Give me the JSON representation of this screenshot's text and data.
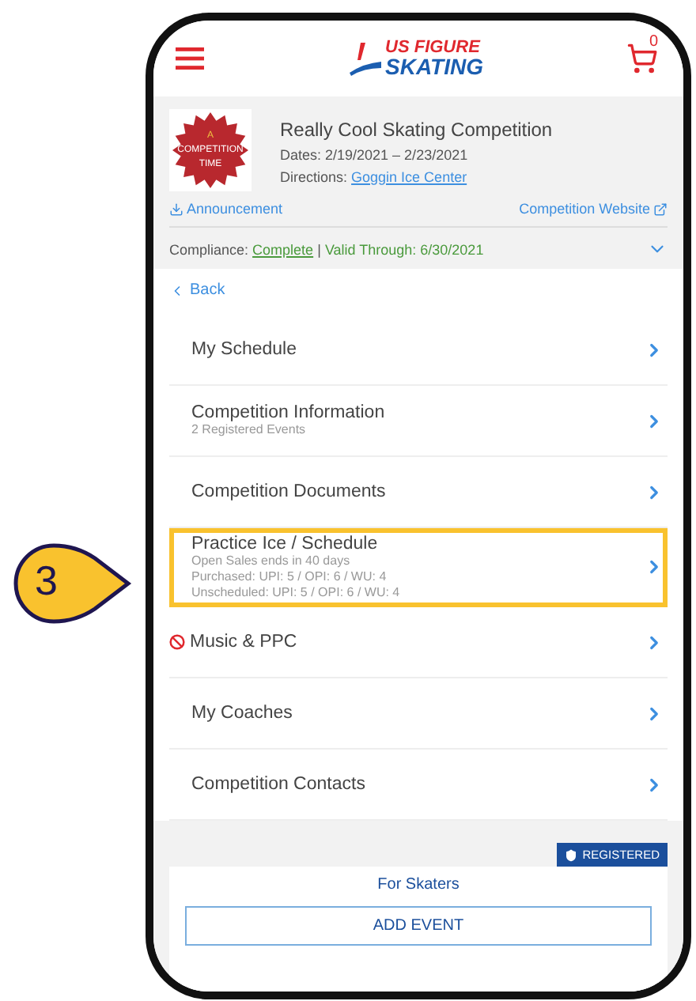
{
  "callout": {
    "number": "3"
  },
  "header": {
    "logo_top": "US FIGURE",
    "logo_bottom": "SKATING",
    "cart_count": "0"
  },
  "competition": {
    "badge_lines": [
      "A",
      "COMPETITION",
      "TIME"
    ],
    "title": "Really Cool Skating Competition",
    "dates": "Dates: 2/19/2021 – 2/23/2021",
    "directions_label": "Directions:",
    "directions_link": "Goggin Ice Center",
    "announcement": "Announcement",
    "website": "Competition Website",
    "compliance_label": "Compliance:",
    "compliance_status": "Complete",
    "separator": "|",
    "valid_through": "Valid Through: 6/30/2021"
  },
  "back": "Back",
  "menu": [
    {
      "title": "My Schedule",
      "highlighted": false,
      "blocked": false
    },
    {
      "title": "Competition Information",
      "lines": [
        "2 Registered Events"
      ],
      "highlighted": false,
      "blocked": false
    },
    {
      "title": "Competition Documents",
      "highlighted": false,
      "blocked": false
    },
    {
      "title": "Practice Ice / Schedule",
      "lines": [
        "Open Sales ends in 40 days",
        "Purchased: UPI: 5 / OPI: 6 / WU: 4",
        "Unscheduled: UPI: 5 / OPI: 6 / WU: 4"
      ],
      "highlighted": true,
      "blocked": false
    },
    {
      "title": "Music & PPC",
      "highlighted": false,
      "blocked": true
    },
    {
      "title": "My Coaches",
      "highlighted": false,
      "blocked": false
    },
    {
      "title": "Competition Contacts",
      "highlighted": false,
      "blocked": false
    }
  ],
  "skaters": {
    "badge": "REGISTERED",
    "title": "For Skaters",
    "button": "ADD EVENT"
  }
}
